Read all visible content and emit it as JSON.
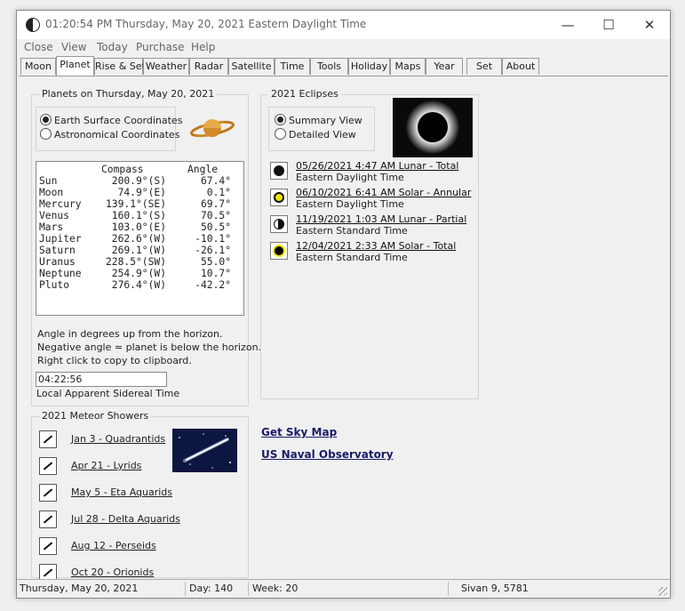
{
  "titlebar": {
    "title": "01:20:54  PM   Thursday, May 20, 2021   Eastern Daylight Time",
    "minimize": "—",
    "maximize": "☐",
    "close": "✕"
  },
  "menu": [
    "Close",
    "View",
    "Today",
    "Purchase",
    "Help"
  ],
  "tabs": [
    "Moon",
    "Planet",
    "Rise & Set",
    "Weather",
    "Radar",
    "Satellite",
    "Time",
    "Tools",
    "Holiday",
    "Maps",
    "Year",
    "Set",
    "About"
  ],
  "active_tab": "Planet",
  "planets": {
    "group_title": "Planets on Thursday, May 20, 2021",
    "coord_options": [
      "Earth Surface Coordinates",
      "Astronomical Coordinates"
    ],
    "selected_coord": "Earth Surface Coordinates",
    "headers": {
      "compass": "Compass",
      "angle": "Angle"
    },
    "rows": [
      {
        "name": "Sun",
        "compass": "200.9°(S)",
        "angle": "67.4°"
      },
      {
        "name": "Moon",
        "compass": "74.9°(E)",
        "angle": "0.1°"
      },
      {
        "name": "Mercury",
        "compass": "139.1°(SE)",
        "angle": "69.7°"
      },
      {
        "name": "Venus",
        "compass": "160.1°(S)",
        "angle": "70.5°"
      },
      {
        "name": "Mars",
        "compass": "103.0°(E)",
        "angle": "50.5°"
      },
      {
        "name": "Jupiter",
        "compass": "262.6°(W)",
        "angle": "-10.1°"
      },
      {
        "name": "Saturn",
        "compass": "269.1°(W)",
        "angle": "-26.1°"
      },
      {
        "name": "Uranus",
        "compass": "228.5°(SW)",
        "angle": "55.0°"
      },
      {
        "name": "Neptune",
        "compass": "254.9°(W)",
        "angle": "10.7°"
      },
      {
        "name": "Pluto",
        "compass": "276.4°(W)",
        "angle": "-42.2°"
      }
    ],
    "notes": [
      "Angle in degrees up from the horizon.",
      "Negative angle = planet is below the horizon.",
      "Right click to copy to clipboard."
    ],
    "sidereal_value": "04:22:56",
    "sidereal_label": "Local Apparent Sidereal Time"
  },
  "eclipses": {
    "group_title": "2021 Eclipses",
    "view_options": [
      "Summary View",
      "Detailed View"
    ],
    "selected_view": "Summary View",
    "items": [
      {
        "link": "05/26/2021   4:47 AM  Lunar - Total",
        "tz": "Eastern Daylight Time",
        "kind": "lunar-total"
      },
      {
        "link": "06/10/2021   6:41 AM  Solar - Annular",
        "tz": "Eastern Daylight Time",
        "kind": "solar-annular"
      },
      {
        "link": "11/19/2021   1:03 AM  Lunar - Partial",
        "tz": "Eastern Standard Time",
        "kind": "lunar-partial"
      },
      {
        "link": "12/04/2021   2:33 AM  Solar - Total",
        "tz": "Eastern Standard Time",
        "kind": "solar-total"
      }
    ]
  },
  "meteors": {
    "group_title": "2021 Meteor Showers",
    "items": [
      "Jan  3 - Quadrantids",
      "Apr 21 - Lyrids",
      "May  5 - Eta Aquarids",
      "Jul 28 - Delta Aquarids",
      "Aug 12 - Perseids",
      "Oct 20 - Orionids"
    ]
  },
  "links": {
    "sky_map": "Get Sky Map",
    "naval": "US Naval Observatory"
  },
  "status": {
    "date": "Thursday, May 20, 2021",
    "day": "Day: 140",
    "week": "Week: 20",
    "hebrew": "Sivan 9, 5781"
  },
  "colors": {
    "eclipse_yellow": "#f2e600",
    "window_bg": "#f0f0f0"
  }
}
